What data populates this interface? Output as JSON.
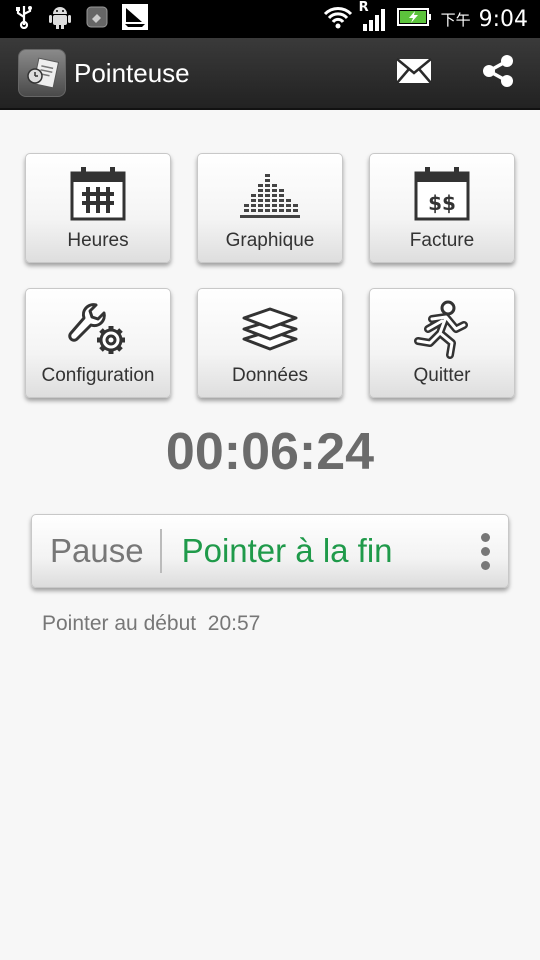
{
  "status_bar": {
    "icons": [
      "usb-icon",
      "android-debug-icon",
      "app-notification-icon",
      "sailboat-icon",
      "wifi-icon",
      "signal-icon",
      "battery-charging-icon"
    ],
    "roaming_label": "R",
    "ampm": "下午",
    "time": "9:04"
  },
  "action_bar": {
    "title": "Pointeuse",
    "actions": [
      "mail-icon",
      "share-icon"
    ]
  },
  "tiles": [
    {
      "label": "Heures",
      "icon": "calendar-grid-icon"
    },
    {
      "label": "Graphique",
      "icon": "bar-graph-icon"
    },
    {
      "label": "Facture",
      "icon": "calendar-dollar-icon"
    },
    {
      "label": "Configuration",
      "icon": "wrench-gear-icon"
    },
    {
      "label": "Données",
      "icon": "layers-icon"
    },
    {
      "label": "Quitter",
      "icon": "running-man-icon"
    }
  ],
  "timer": "00:06:24",
  "punch": {
    "pause_label": "Pause",
    "end_label": "Pointer à la fin"
  },
  "start_info": {
    "label": "Pointer au début",
    "time": "20:57"
  },
  "colors": {
    "accent_green": "#1f9a4a",
    "timer_gray": "#6b6b6b",
    "action_bar": "#2a2a2a"
  }
}
